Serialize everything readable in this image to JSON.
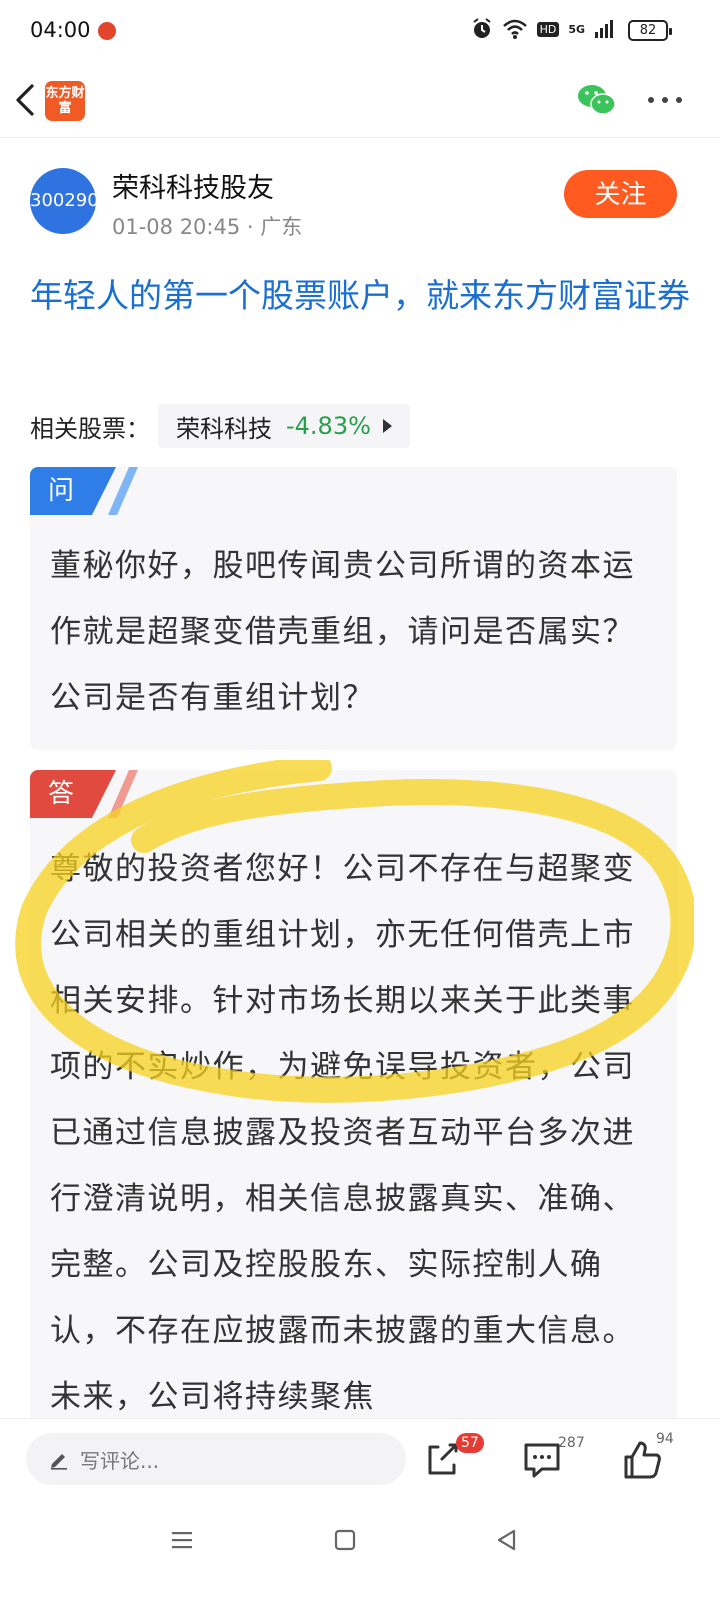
{
  "status_bar": {
    "time": "04:00",
    "battery": "82",
    "network": "5G",
    "hd": "HD"
  },
  "header": {
    "logo_text": "东方财富"
  },
  "author": {
    "avatar_text": "300290",
    "name": "荣科科技股友",
    "meta": "01-08 20:45 · 广东",
    "follow_label": "关注"
  },
  "post": {
    "title": "年轻人的第一个股票账户，就来东方财富证券"
  },
  "related": {
    "label": "相关股票：",
    "stock_name": "荣科科技",
    "change": "-4.83%",
    "change_color": "#27a04b"
  },
  "question": {
    "tag": "问",
    "text": "董秘你好，股吧传闻贵公司所谓的资本运作就是超聚变借壳重组，请问是否属实？公司是否有重组计划？"
  },
  "answer": {
    "tag": "答",
    "text": "尊敬的投资者您好！公司不存在与超聚变公司相关的重组计划，亦无任何借壳上市相关安排。针对市场长期以来关于此类事项的不实炒作，为避免误导投资者，公司已通过信息披露及投资者互动平台多次进行澄清说明，相关信息披露真实、准确、完整。公司及控股股东、实际控制人确认，不存在应披露而未披露的重大信息。未来，公司将持续聚焦"
  },
  "bottom_bar": {
    "comment_placeholder": "写评论...",
    "share_badge": "57",
    "comment_count": "287",
    "like_count": "94"
  },
  "colors": {
    "accent_orange": "#ff5a1f",
    "title_blue": "#1a6fd0",
    "highlight_yellow": "#f7d21e"
  }
}
